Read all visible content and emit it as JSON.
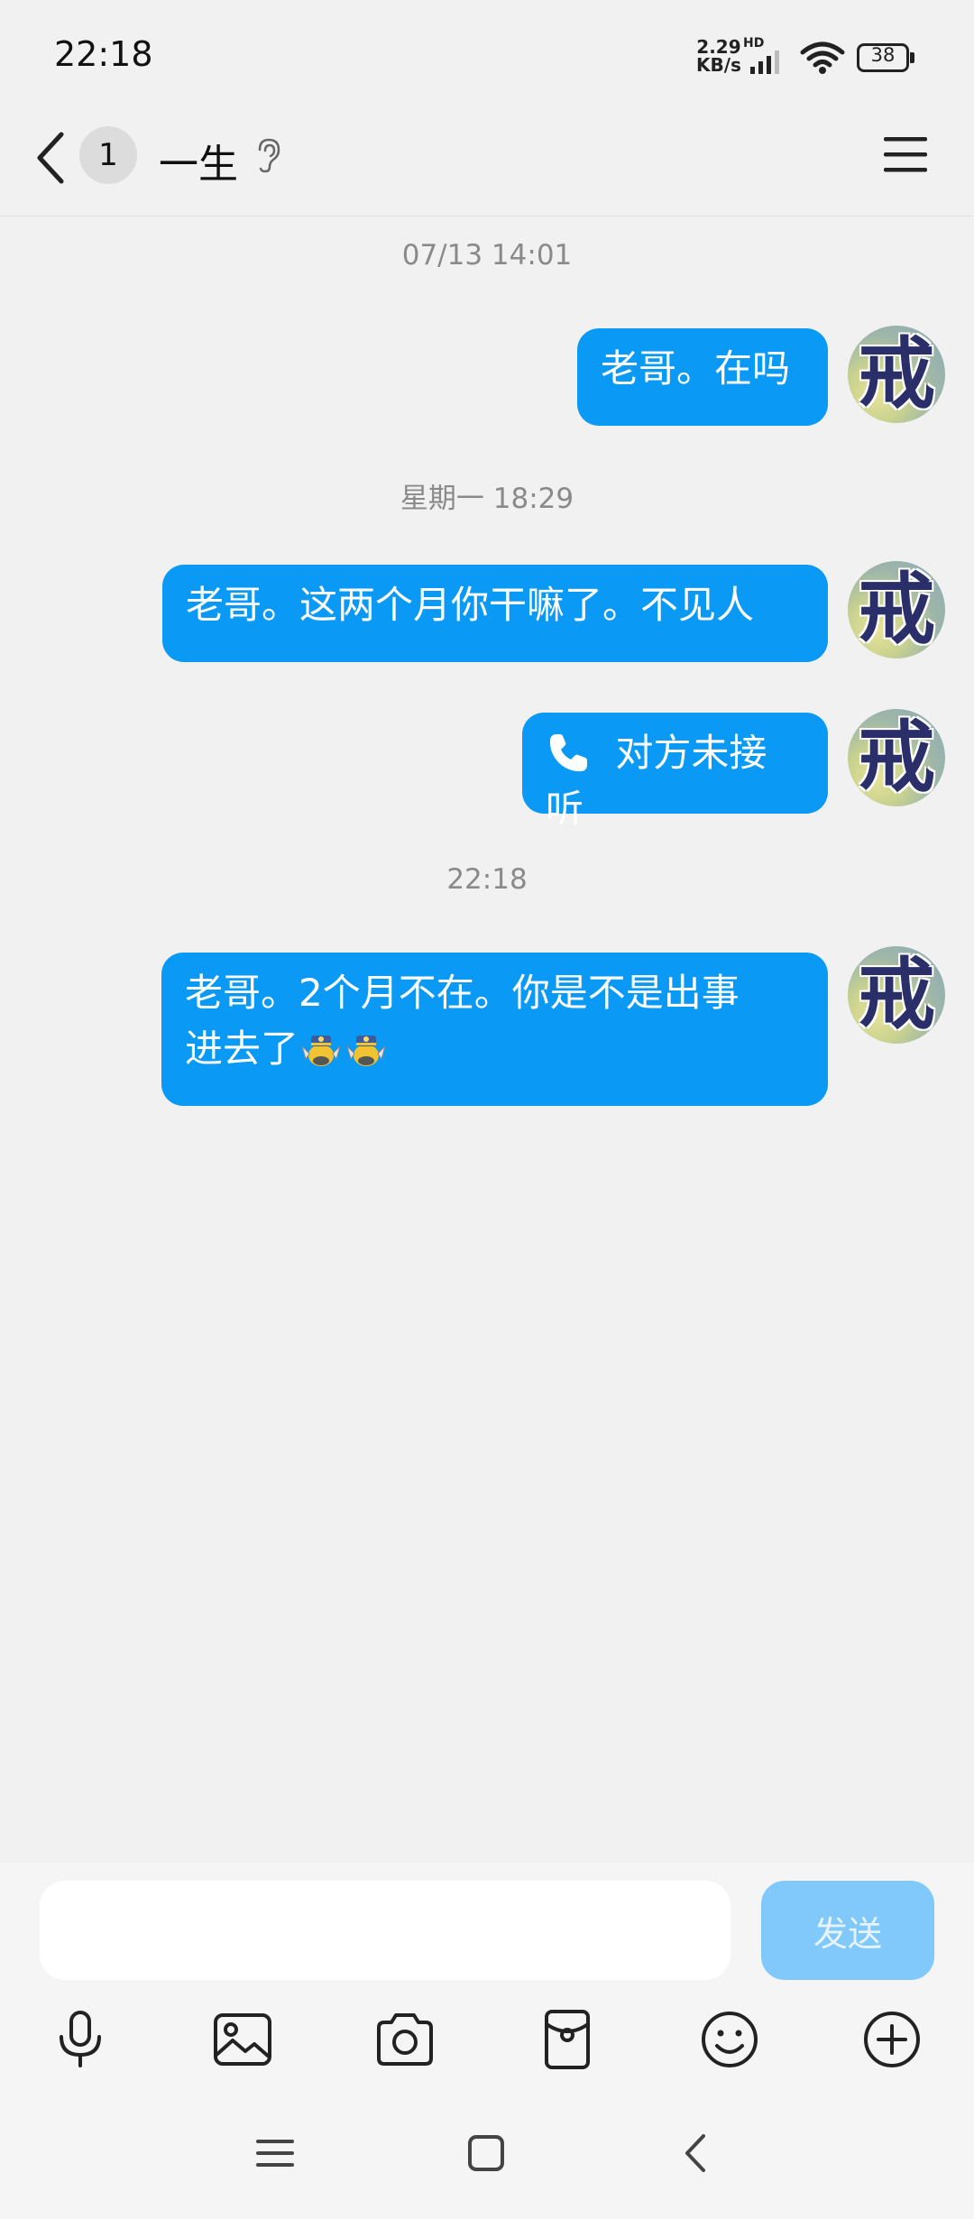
{
  "status_bar": {
    "time": "22:18",
    "net_speed_value": "2.29",
    "net_speed_unit": "KB/s",
    "network_label": "HD",
    "battery": "38"
  },
  "header": {
    "unread_count": "1",
    "contact_name": "一生"
  },
  "messages": [
    {
      "type": "timestamp",
      "text": "07/13 14:01"
    },
    {
      "type": "sent",
      "text": "老哥。在吗",
      "avatar_char": "戒"
    },
    {
      "type": "timestamp",
      "text": "星期一 18:29"
    },
    {
      "type": "sent",
      "text": "老哥。这两个月你干嘛了。不见人",
      "avatar_char": "戒"
    },
    {
      "type": "call",
      "text": "对方未接听",
      "avatar_char": "戒"
    },
    {
      "type": "timestamp",
      "text": "22:18"
    },
    {
      "type": "sent",
      "text_line1": "老哥。2个月不在。你是不是出事",
      "text_line2": "进去了",
      "avatar_char": "戒"
    }
  ],
  "composer": {
    "input_value": "",
    "send_label": "发送"
  },
  "colors": {
    "bubble": "#0a99f5",
    "send_disabled": "#81c9fa",
    "background": "#f1f1f1"
  },
  "icons": {
    "toolbar": [
      "microphone-icon",
      "image-icon",
      "camera-icon",
      "red-packet-icon",
      "emoji-icon",
      "plus-icon"
    ],
    "nav": [
      "menu-icon",
      "home-icon",
      "back-icon"
    ]
  }
}
